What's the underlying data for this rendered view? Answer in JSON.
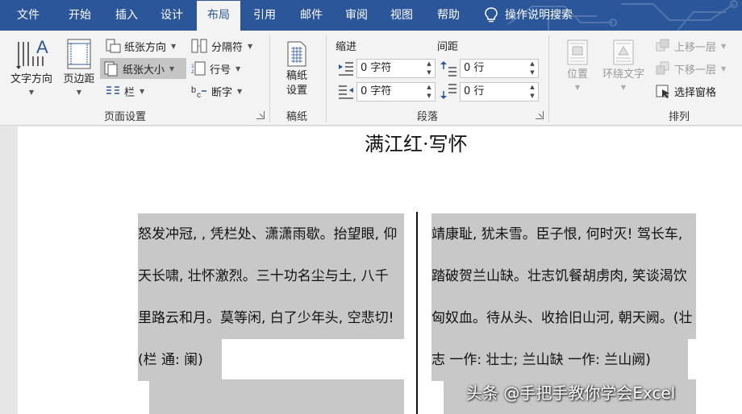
{
  "tabs": [
    "文件",
    "开始",
    "插入",
    "设计",
    "布局",
    "引用",
    "邮件",
    "审阅",
    "视图",
    "帮助"
  ],
  "active_tab": "布局",
  "tell_me": "操作说明搜索",
  "page_setup": {
    "text_direction": "文字方向",
    "margins": "页边距",
    "orientation": "纸张方向",
    "size": "纸张大小",
    "columns": "栏",
    "breaks": "分隔符",
    "line_numbers": "行号",
    "hyphenation": "断字",
    "group_label": "页面设置"
  },
  "draft": {
    "button": [
      "稿纸",
      "设置"
    ],
    "group_label": "稿纸"
  },
  "paragraph": {
    "indent_label": "缩进",
    "spacing_label": "间距",
    "indent_left": "0 字符",
    "indent_right": "0 字符",
    "spacing_before": "0 行",
    "spacing_after": "0 行",
    "group_label": "段落"
  },
  "arrange": {
    "position": "位置",
    "wrap_text": "环绕文字",
    "bring_forward": "上移一层",
    "send_backward": "下移一层",
    "selection_pane": "选择窗格",
    "group_label": "排列"
  },
  "document": {
    "title": "满江红·写怀",
    "left_column": [
      "怒发冲冠, , 凭栏处、潇潇雨歇。抬望眼, 仰",
      "天长啸, 壮怀激烈。三十功名尘与土, 八千",
      "里路云和月。莫等闲, 白了少年头, 空悲切!",
      "(栏  通: 阑)"
    ],
    "right_column": [
      "靖康耻, 犹未雪。臣子恨, 何时灭! 驾长车,",
      "踏破贺兰山缺。壮志饥餐胡虏肉, 笑谈渴饮",
      "匈奴血。待从头、收拾旧山河, 朝天阙。(壮",
      "志  一作: 壮士; 兰山缺  一作: 兰山阙)"
    ]
  },
  "watermark": "头条 @手把手教你学会Excel"
}
